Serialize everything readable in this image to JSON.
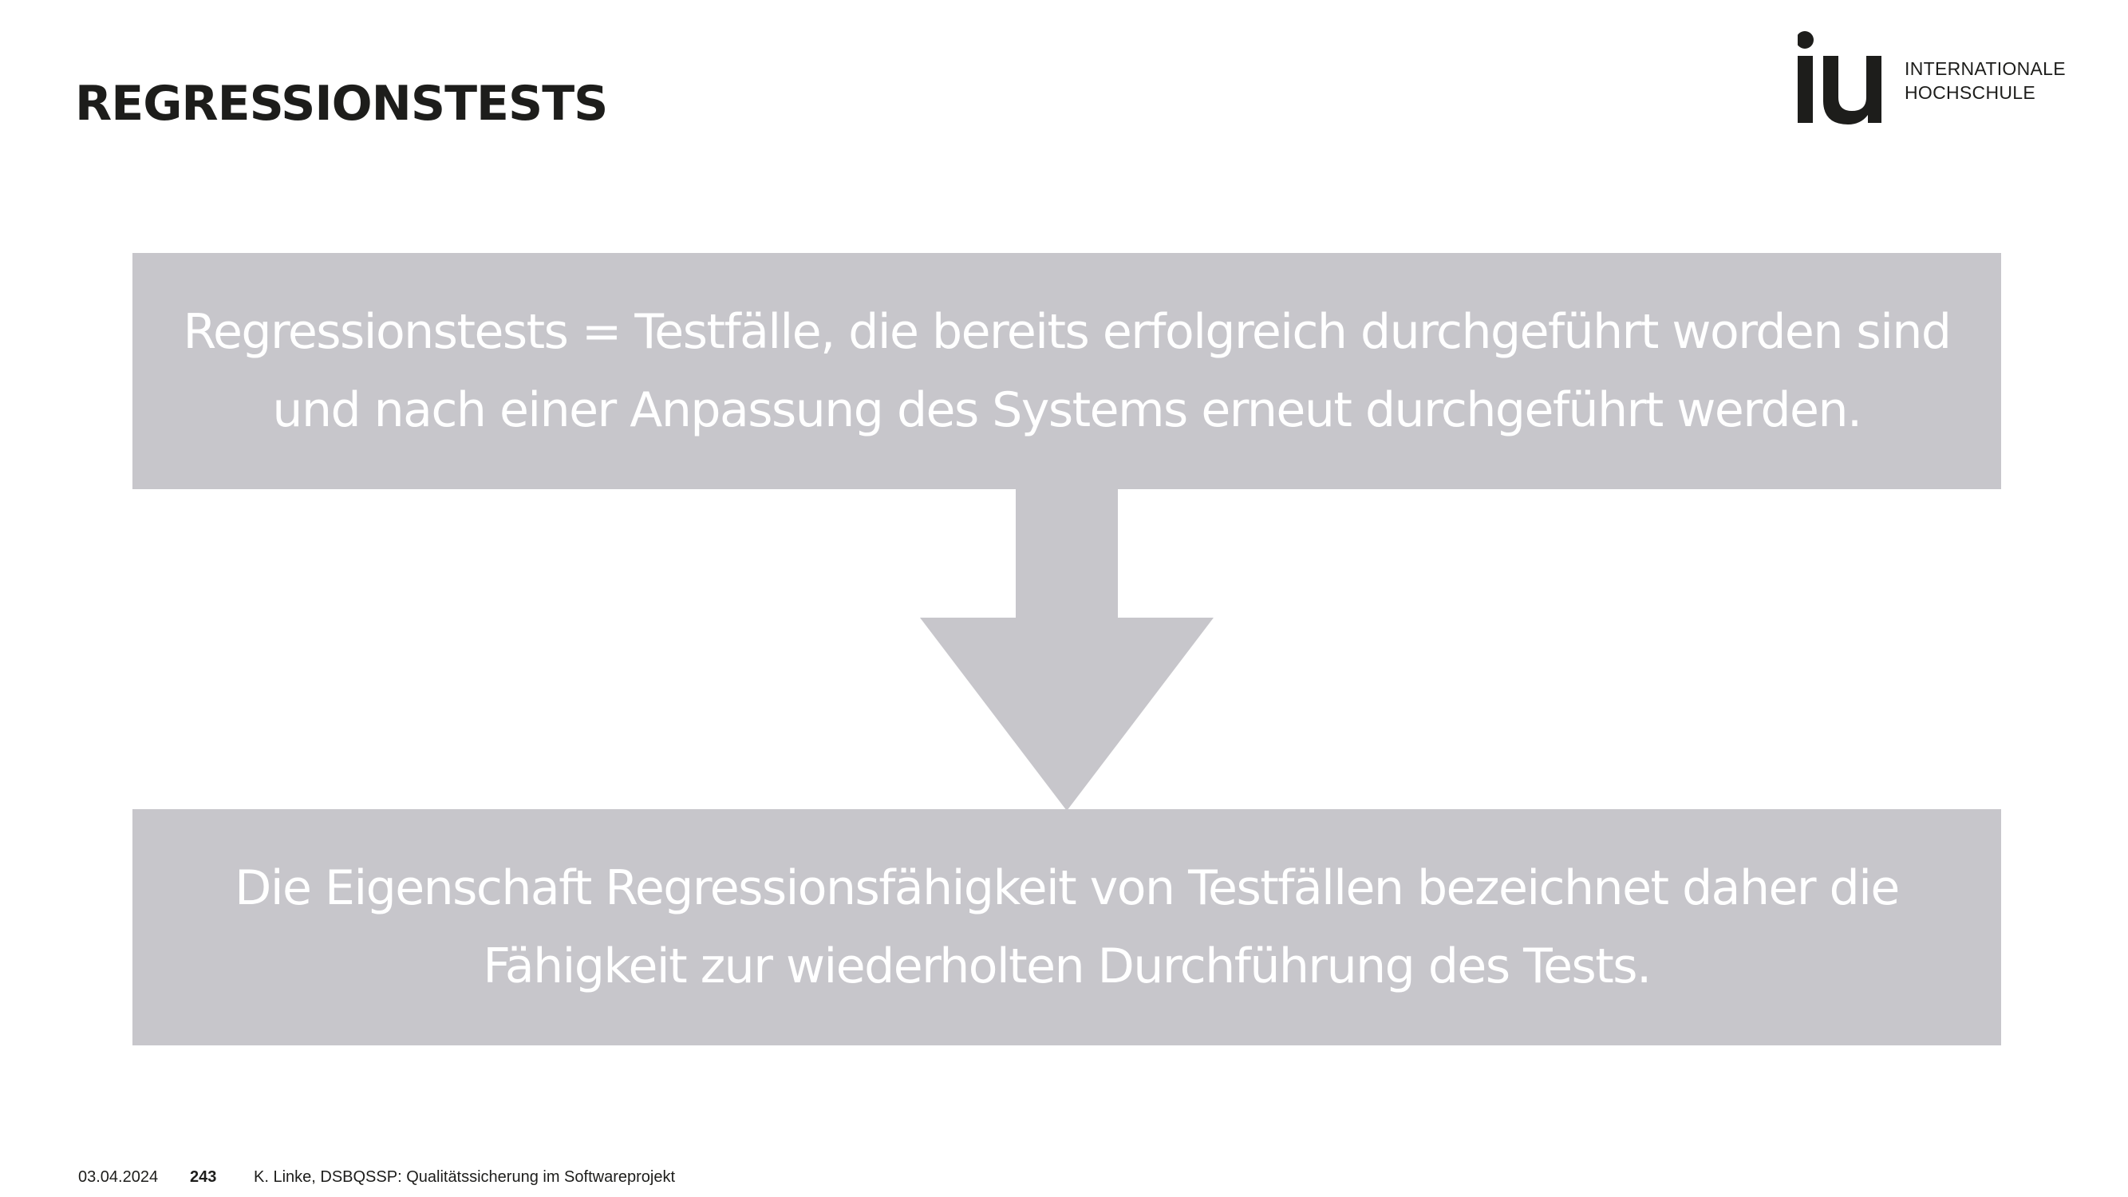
{
  "slide": {
    "title": "REGRESSIONSTESTS"
  },
  "logo": {
    "line1": "INTERNATIONALE",
    "line2": "HOCHSCHULE"
  },
  "content": {
    "definition": "Regressionstests = Testfälle, die bereits erfolgreich durchgeführt worden sind und nach einer Anpassung des Systems erneut durchgeführt werden.",
    "conclusion": "Die Eigenschaft Regressionsfähigkeit von Testfällen bezeichnet daher die Fähigkeit zur wiederholten Durchführung des Tests."
  },
  "footer": {
    "date": "03.04.2024",
    "page": "243",
    "author_course": "K. Linke, DSBQSSP: Qualitätssicherung im Softwareprojekt"
  },
  "colors": {
    "box_fill": "#c7c6cb",
    "box_text": "#ffffff",
    "title": "#1d1d1b"
  }
}
